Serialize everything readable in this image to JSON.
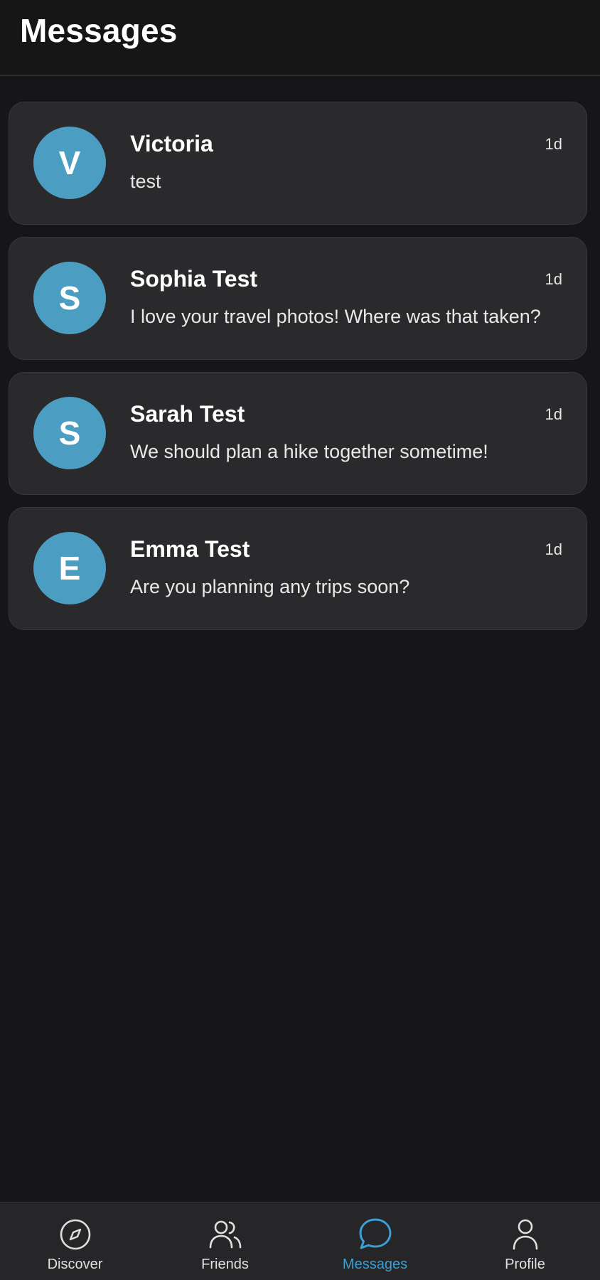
{
  "header": {
    "title": "Messages"
  },
  "conversations": [
    {
      "initial": "V",
      "name": "Victoria",
      "time": "1d",
      "preview": "test"
    },
    {
      "initial": "S",
      "name": "Sophia Test",
      "time": "1d",
      "preview": "I love your travel photos! Where was that taken?"
    },
    {
      "initial": "S",
      "name": "Sarah Test",
      "time": "1d",
      "preview": "We should plan a hike together sometime!"
    },
    {
      "initial": "E",
      "name": "Emma Test",
      "time": "1d",
      "preview": "Are you planning any trips soon?"
    }
  ],
  "tabbar": {
    "tabs": [
      {
        "label": "Discover",
        "icon": "compass-icon"
      },
      {
        "label": "Friends",
        "icon": "friends-icon"
      },
      {
        "label": "Messages",
        "icon": "chat-bubble-icon",
        "active": true
      },
      {
        "label": "Profile",
        "icon": "person-icon"
      }
    ]
  },
  "colors": {
    "accent": "#3a9fd4",
    "avatar": "#4b9dc2",
    "background": "#161618",
    "card": "#2a2a2c"
  }
}
